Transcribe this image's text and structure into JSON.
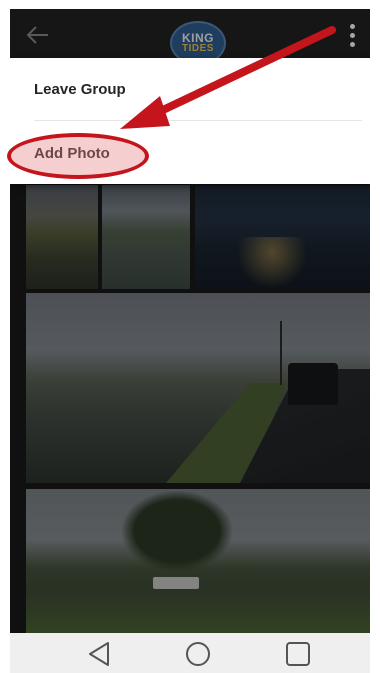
{
  "app_bar": {
    "logo_line1": "KING",
    "logo_line2": "TIDES"
  },
  "menu": {
    "items": [
      {
        "label": "Leave Group"
      },
      {
        "label": "Add Photo"
      }
    ]
  },
  "annotation": {
    "highlight_color": "#c4151c",
    "arrow_color": "#c4151c"
  },
  "icons": {
    "back": "back-arrow-icon",
    "overflow": "overflow-menu-icon",
    "nav_back": "nav-back-icon",
    "nav_home": "nav-home-icon",
    "nav_recent": "nav-recent-apps-icon"
  }
}
